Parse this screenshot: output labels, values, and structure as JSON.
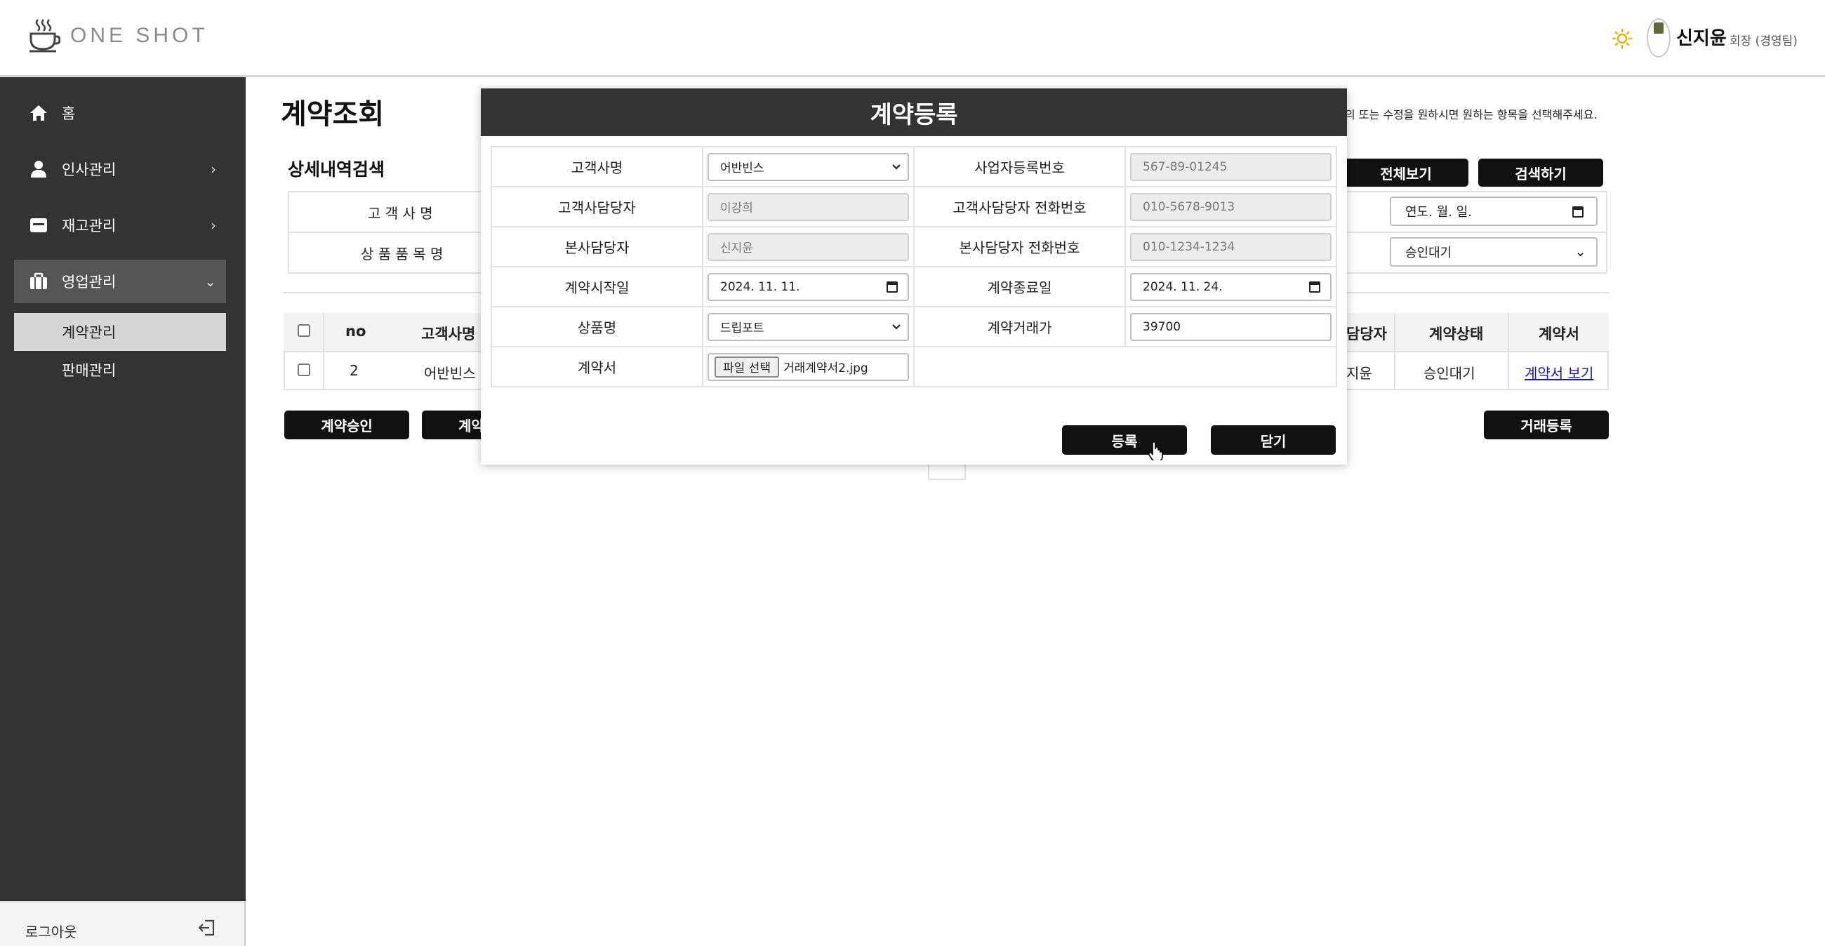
{
  "header": {
    "logo_text": "ONE SHOT",
    "user_name": "신지윤",
    "user_role": "회장 (경영팀)"
  },
  "sidebar": {
    "items": [
      {
        "label": "홈",
        "icon": "home-icon"
      },
      {
        "label": "인사관리",
        "icon": "person-icon"
      },
      {
        "label": "재고관리",
        "icon": "box-icon"
      },
      {
        "label": "영업관리",
        "icon": "briefcase-icon"
      }
    ],
    "sub_items": [
      {
        "label": "계약관리"
      },
      {
        "label": "판매관리"
      }
    ],
    "logout_label": "로그아웃"
  },
  "page": {
    "title": "계약조회",
    "help_text": "의 또는 수정을 원하시면 원하는 항목을 선택해주세요.",
    "search_heading": "상세내역검색",
    "search_labels": [
      "고 객 사 명",
      "상 품 품 목 명"
    ],
    "btn_all": "전체보기",
    "btn_search": "검색하기",
    "date_placeholder": "연도. 월. 일.",
    "status_select": "승인대기",
    "table": {
      "headers": [
        "no",
        "고객사명",
        "담당자",
        "계약상태",
        "계약서"
      ],
      "row": {
        "no": "2",
        "customer": "어반빈스",
        "manager": "지윤",
        "status": "승인대기",
        "contract_link": "계약서 보기"
      }
    },
    "btn_approve": "계약승인",
    "btn_second_partial": "계약",
    "btn_trade_register": "거래등록"
  },
  "modal": {
    "title": "계약등록",
    "labels": {
      "customer": "고객사명",
      "biz_no": "사업자등록번호",
      "customer_manager": "고객사담당자",
      "customer_phone": "고객사담당자 전화번호",
      "hq_manager": "본사담당자",
      "hq_phone": "본사담당자 전화번호",
      "start_date": "계약시작일",
      "end_date": "계약종료일",
      "product": "상품명",
      "price": "계약거래가",
      "contract_file": "계약서"
    },
    "values": {
      "customer": "어반빈스",
      "biz_no": "567-89-01245",
      "customer_manager": "이강희",
      "customer_phone": "010-5678-9013",
      "hq_manager": "신지윤",
      "hq_phone": "010-1234-1234",
      "start_date": "2024. 11. 11.",
      "end_date": "2024. 11. 24.",
      "product": "드립포트",
      "price": "39700",
      "file_button": "파일 선택",
      "file_name": "거래계약서2.jpg"
    },
    "btn_register": "등록",
    "btn_close": "닫기"
  }
}
